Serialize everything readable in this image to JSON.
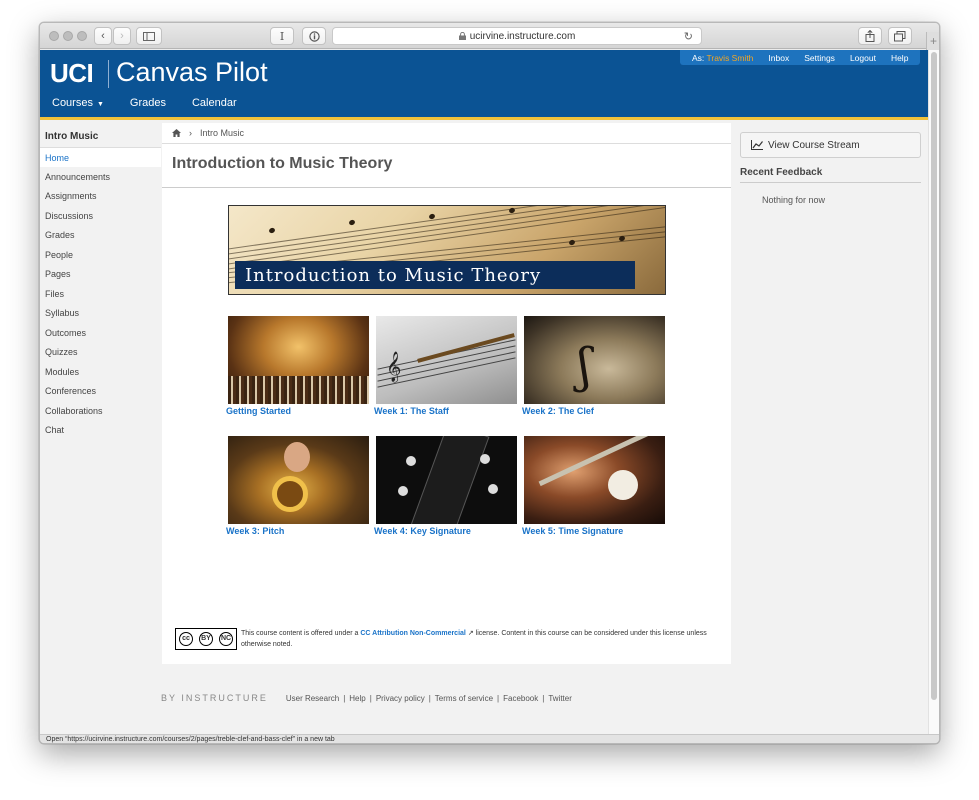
{
  "browser": {
    "url": "ucirvine.instructure.com",
    "status_text": "Open “https://ucirvine.instructure.com/courses/2/pages/treble-clef-and-bass-clef” in a new tab"
  },
  "header": {
    "logo_uci": "UCI",
    "logo_product": "Canvas Pilot",
    "as_label": "As:",
    "user_name": "Travis Smith",
    "user_links": [
      "Inbox",
      "Settings",
      "Logout",
      "Help"
    ],
    "nav": [
      "Courses",
      "Grades",
      "Calendar"
    ]
  },
  "sidebar": {
    "course_name": "Intro Music",
    "items": [
      "Home",
      "Announcements",
      "Assignments",
      "Discussions",
      "Grades",
      "People",
      "Pages",
      "Files",
      "Syllabus",
      "Outcomes",
      "Quizzes",
      "Modules",
      "Conferences",
      "Collaborations",
      "Chat"
    ]
  },
  "breadcrumb": {
    "current": "Intro Music"
  },
  "page": {
    "title": "Introduction to Music Theory",
    "banner_text": "Introduction to Music Theory",
    "tiles": [
      "Getting Started",
      "Week 1: The Staff",
      "Week 2: The Clef",
      "Week 3: Pitch",
      "Week 4: Key Signature",
      "Week 5: Time Signature"
    ],
    "license_prefix": "This course content is offered under a",
    "license_link": "CC Attribution Non-Commercial",
    "license_suffix": "license. Content in this course can be considered under this license unless otherwise noted.",
    "cc_badge": {
      "cc": "cc",
      "by": "BY",
      "nc": "NC"
    }
  },
  "right": {
    "stream_button": "View Course Stream",
    "feedback_title": "Recent Feedback",
    "feedback_empty": "Nothing for now"
  },
  "footer": {
    "brand": "BY INSTRUCTURE",
    "links": [
      "User Research",
      "Help",
      "Privacy policy",
      "Terms of service",
      "Facebook",
      "Twitter"
    ]
  }
}
